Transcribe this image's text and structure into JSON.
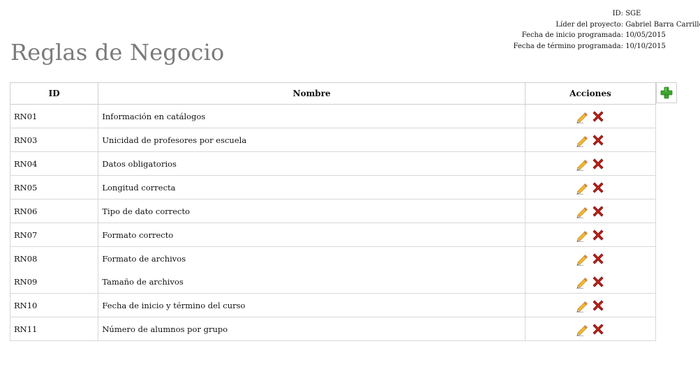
{
  "project": {
    "id_label": "ID:",
    "id_value": "SGE",
    "leader_label": "Líder del proyecto:",
    "leader_value": "Gabriel Barra Carrillo",
    "start_label": "Fecha de inicio programada:",
    "start_value": "10/05/2015",
    "end_label": "Fecha de término programada:",
    "end_value": "10/10/2015"
  },
  "page_title": "Reglas de Negocio",
  "table": {
    "headers": {
      "id": "ID",
      "name": "Nombre",
      "actions": "Acciones"
    },
    "rows": [
      {
        "id": "RN01",
        "name": "Información en catálogos"
      },
      {
        "id": "RN03",
        "name": "Unicidad de profesores por escuela"
      },
      {
        "id": "RN04",
        "name": "Datos obligatorios"
      },
      {
        "id": "RN05",
        "name": "Longitud correcta"
      },
      {
        "id": "RN06",
        "name": "Tipo de dato correcto"
      },
      {
        "id": "RN07",
        "name": "Formato correcto"
      },
      {
        "id": "RN08",
        "name": "Formato de archivos"
      },
      {
        "id": "RN09",
        "name": "Tamaño de archivos"
      },
      {
        "id": "RN10",
        "name": "Fecha de inicio y término del curso"
      },
      {
        "id": "RN11",
        "name": "Número de alumnos por grupo"
      }
    ]
  },
  "icons": {
    "edit": "pencil-icon",
    "delete": "delete-x-icon",
    "add": "plus-icon"
  },
  "colors": {
    "title": "#7a7a7a",
    "delete": "#c0201a",
    "add": "#3aa52b",
    "pencil": "#f2b632"
  }
}
